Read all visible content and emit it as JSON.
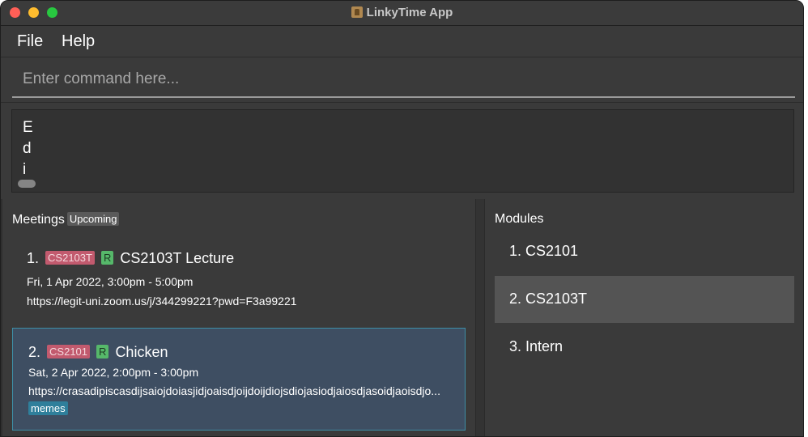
{
  "window": {
    "title": "LinkyTime App"
  },
  "menu": {
    "file_label": "File",
    "help_label": "Help"
  },
  "command": {
    "placeholder": "Enter command here...",
    "value": ""
  },
  "result": {
    "text": "Edi"
  },
  "meetings": {
    "title": "Meetings",
    "filter_label": "Upcoming",
    "items": [
      {
        "index": "1.",
        "module": "CS2103T",
        "recurring": "R",
        "name": "CS2103T Lecture",
        "datetime": "Fri, 1 Apr 2022, 3:00pm  -  5:00pm",
        "link": "https://legit-uni.zoom.us/j/344299221?pwd=F3a99221",
        "selected": false
      },
      {
        "index": "2.",
        "module": "CS2101",
        "recurring": "R",
        "name": "Chicken",
        "datetime": "Sat, 2 Apr 2022, 2:00pm  -  3:00pm",
        "link": "https://crasadipiscasdijsaiojdoiasjidjoaisdjoijdoijdiojsdiojasiodjaiosdjasoidjaoisdjo...",
        "tag": "memes",
        "selected": true
      }
    ]
  },
  "modules": {
    "title": "Modules",
    "items": [
      {
        "label": "1.  CS2101",
        "selected": false
      },
      {
        "label": "2.  CS2103T",
        "selected": true
      },
      {
        "label": "3.  Intern",
        "selected": false
      }
    ]
  },
  "colors": {
    "module_tag": "#c25a6e",
    "recurring_tag": "#56b86a",
    "note_tag": "#2f7f9b",
    "selected_card": "#3e4e62",
    "selected_border": "#3d8ea6",
    "selected_module": "#545454"
  }
}
